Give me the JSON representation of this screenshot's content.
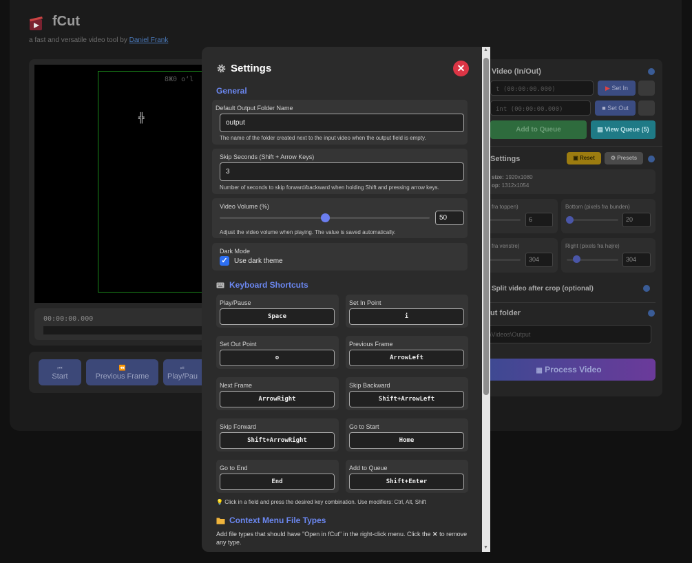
{
  "app": {
    "title": "fCut",
    "subtitle_prefix": "a fast and versatile video tool by ",
    "author_link": "Daniel Frank"
  },
  "player": {
    "overlay_text": "8Ж0 oʻl",
    "station_glyph": "╬",
    "timecode": "00:00:00.000"
  },
  "controls": [
    {
      "icon": "start-icon",
      "label": "Start"
    },
    {
      "icon": "previous-frame-icon",
      "label": "Previous Frame"
    },
    {
      "icon": "play-pause-icon",
      "label": "Play/Pau"
    }
  ],
  "right_panel": {
    "trim_title": "Video (In/Out)",
    "in_placeholder": "t (00:00:00.000)",
    "out_placeholder": "int (00:00:00.000)",
    "set_in": "Set In",
    "set_out": "Set Out",
    "add_to_queue": "Add to Queue",
    "view_queue": "View Queue (5)",
    "crop_title": "Settings",
    "reset": "Reset",
    "presets": "Presets",
    "size_label": "size:",
    "size_value": "1920x1080",
    "crop_label": "op:",
    "crop_value": "1312x1054",
    "top_label": "ls fra toppen)",
    "top_value": "6",
    "bottom_label": "Bottom (pixels fra bunden)",
    "bottom_value": "20",
    "left_label": "ls fra venstre)",
    "left_value": "304",
    "right_label": "Right (pixels fra højre)",
    "right_value": "304",
    "split_label": "Split video after crop (optional)",
    "output_title": "ut folder",
    "output_value": "\\Videos\\Output",
    "process": "Process Video"
  },
  "settings": {
    "title": "Settings",
    "close_symbol": "✕",
    "general_heading": "General",
    "output_folder": {
      "label": "Default Output Folder Name",
      "value": "output",
      "hint": "The name of the folder created next to the input video when the output field is empty."
    },
    "skip_seconds": {
      "label": "Skip Seconds (Shift + Arrow Keys)",
      "value": "3",
      "hint": "Number of seconds to skip forward/backward when holding Shift and pressing arrow keys."
    },
    "volume": {
      "label": "Video Volume (%)",
      "value": "50",
      "level": 0.5,
      "hint": "Adjust the video volume when playing. The value is saved automatically."
    },
    "dark_mode": {
      "label": "Dark Mode",
      "checkbox_label": "Use dark theme",
      "checked": true
    },
    "shortcuts_heading": "Keyboard Shortcuts",
    "shortcuts": [
      {
        "label": "Play/Pause",
        "key": "Space"
      },
      {
        "label": "Set In Point",
        "key": "i"
      },
      {
        "label": "Set Out Point",
        "key": "o"
      },
      {
        "label": "Previous Frame",
        "key": "ArrowLeft"
      },
      {
        "label": "Next Frame",
        "key": "ArrowRight"
      },
      {
        "label": "Skip Backward",
        "key": "Shift+ArrowLeft"
      },
      {
        "label": "Skip Forward",
        "key": "Shift+ArrowRight"
      },
      {
        "label": "Go to Start",
        "key": "Home"
      },
      {
        "label": "Go to End",
        "key": "End"
      },
      {
        "label": "Add to Queue",
        "key": "Shift+Enter"
      }
    ],
    "shortcut_note": "Click in a field and press the desired key combination. Use modifiers: Ctrl, Alt, Shift",
    "context_heading": "Context Menu File Types",
    "context_text_1": "Add file types that should have \"Open in fCut\" in the right-click menu. Click the ",
    "context_x": "✕",
    "context_text_2": " to remove any type."
  },
  "colors": {
    "accent": "#6b87f0",
    "close": "#dc3545",
    "checkbox": "#2d6ff2",
    "modal_bg": "#2b2b2b",
    "card_bg": "#353535"
  }
}
